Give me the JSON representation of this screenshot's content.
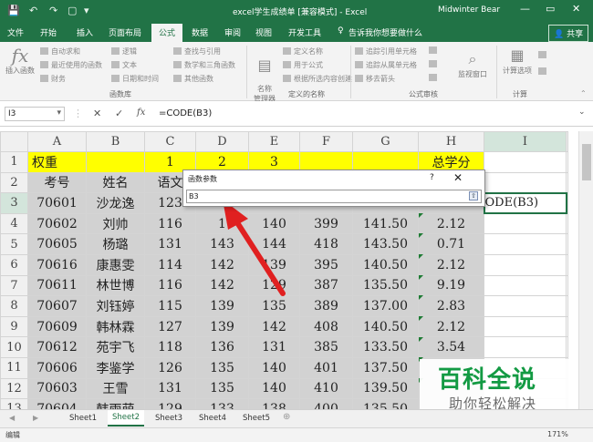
{
  "window": {
    "title": "excel学生成绩单  [兼容模式]  -  Excel",
    "user": "Midwinter Bear",
    "minimize": "—",
    "restore": "▭",
    "close": "✕"
  },
  "quick_access": {
    "save": "💾",
    "undo": "↶",
    "redo": "↷",
    "doc": "▢",
    "more": "▾"
  },
  "ribbon_tabs": [
    "文件",
    "开始",
    "插入",
    "页面布局",
    "公式",
    "数据",
    "审阅",
    "视图",
    "开发工具"
  ],
  "active_tab": "公式",
  "tell_me": "告诉我你想要做什么",
  "share": "共享",
  "ribbon": {
    "insert_function": "插入函数",
    "autosum": "自动求和",
    "recent": "最近使用的函数",
    "financial": "财务",
    "logical": "逻辑",
    "text": "文本",
    "datetime": "日期和时间",
    "lookup": "查找与引用",
    "math": "数学和三角函数",
    "other": "其他函数",
    "name_manager": "名称\n管理器",
    "define_name": "定义名称",
    "use_in_formula": "用于公式",
    "create_from_selection": "根据所选内容创建",
    "trace_precedents": "追踪引用单元格",
    "trace_dependents": "追踪从属单元格",
    "remove_arrows": "移去箭头",
    "watch_window": "监视窗口",
    "calc_options": "计算选项",
    "group_function_library": "函数库",
    "group_defined_names": "定义的名称",
    "group_formula_auditing": "公式审核",
    "group_calculation": "计算"
  },
  "formula_bar": {
    "name_box": "I3",
    "cancel": "✕",
    "enter": "✓",
    "fx": "fx",
    "formula": "=CODE(B3)"
  },
  "columns": [
    "A",
    "B",
    "C",
    "D",
    "E",
    "F",
    "G",
    "H",
    "I"
  ],
  "rows": [
    [
      "权重",
      "",
      "1",
      "2",
      "3",
      "",
      "",
      "总学分",
      ""
    ],
    [
      "考号",
      "姓名",
      "语文",
      "",
      "",
      "",
      "",
      "",
      ""
    ],
    [
      "70601",
      "沙龙逸",
      "123",
      "",
      "",
      "",
      "",
      "",
      "ODE(B3)"
    ],
    [
      "70602",
      "刘帅",
      "116",
      "1",
      "140",
      "399",
      "141.50",
      "2.12",
      ""
    ],
    [
      "70605",
      "杨璐",
      "131",
      "143",
      "144",
      "418",
      "143.50",
      "0.71",
      ""
    ],
    [
      "70616",
      "康惠雯",
      "114",
      "142",
      "139",
      "395",
      "140.50",
      "2.12",
      ""
    ],
    [
      "70611",
      "林世博",
      "116",
      "142",
      "129",
      "387",
      "135.50",
      "9.19",
      ""
    ],
    [
      "70607",
      "刘钰婷",
      "115",
      "139",
      "135",
      "389",
      "137.00",
      "2.83",
      ""
    ],
    [
      "70609",
      "韩林霖",
      "127",
      "139",
      "142",
      "408",
      "140.50",
      "2.12",
      ""
    ],
    [
      "70612",
      "苑宇飞",
      "118",
      "136",
      "131",
      "385",
      "133.50",
      "3.54",
      ""
    ],
    [
      "70606",
      "李鉴学",
      "126",
      "135",
      "140",
      "401",
      "137.50",
      "",
      ""
    ],
    [
      "70603",
      "王雪",
      "131",
      "135",
      "140",
      "410",
      "139.50",
      "",
      ""
    ],
    [
      "70604",
      "韩雨萌",
      "129",
      "133",
      "138",
      "400",
      "135.50",
      "",
      ""
    ]
  ],
  "dialog": {
    "title": "函数参数",
    "help": "?",
    "close": "✕",
    "value": "B3",
    "collapse": "⇧"
  },
  "sheets": [
    "Sheet1",
    "Sheet2",
    "Sheet3",
    "Sheet4",
    "Sheet5"
  ],
  "active_sheet": "Sheet2",
  "status": {
    "mode": "编辑",
    "zoom": "171%"
  },
  "watermark": {
    "line1": "百科全说",
    "line2": "助你轻松解决"
  },
  "colors": {
    "excel_green": "#217346",
    "yellow": "#ffff00",
    "gray_cells": "#d2d2d2",
    "arrow_red": "#e02020",
    "watermark_green": "#139a43"
  }
}
